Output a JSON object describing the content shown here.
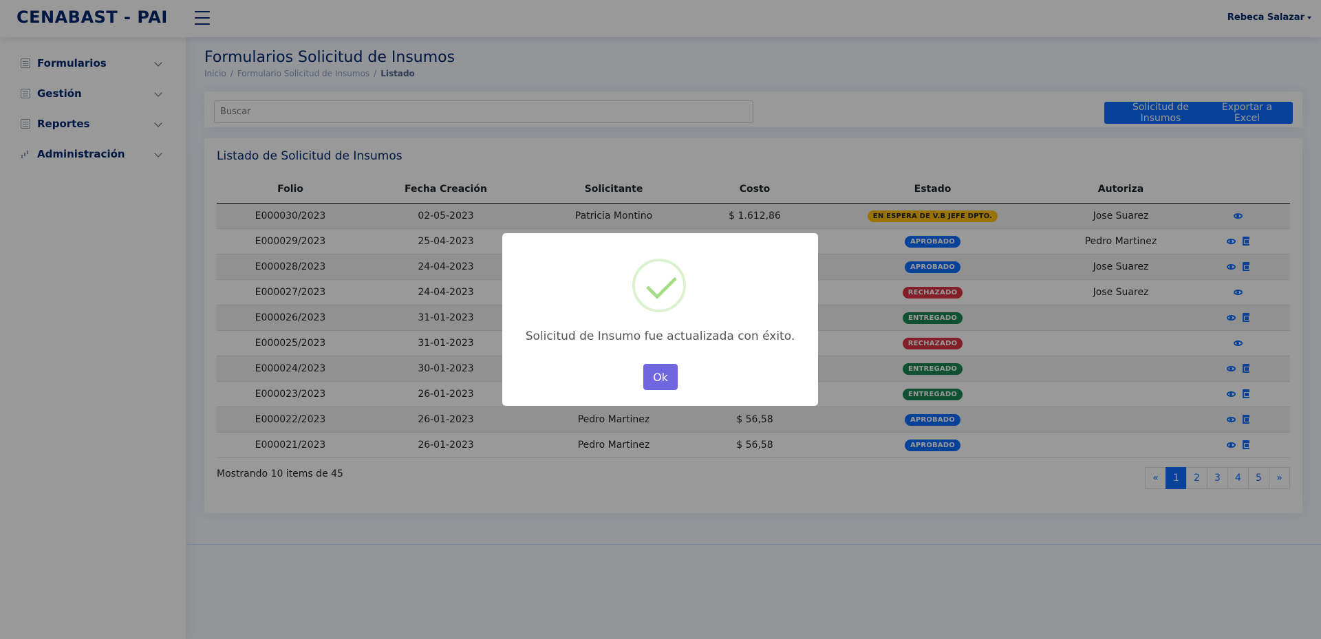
{
  "header": {
    "logo": "CENABAST - PAI",
    "user_name": "Rebeca Salazar"
  },
  "sidebar": {
    "items": [
      {
        "label": "Formularios",
        "icon": "list-icon"
      },
      {
        "label": "Gestión",
        "icon": "document-icon"
      },
      {
        "label": "Reportes",
        "icon": "table-icon"
      },
      {
        "label": "Administración",
        "icon": "bar-chart-icon"
      }
    ]
  },
  "page": {
    "title": "Formularios Solicitud de Insumos",
    "breadcrumb": [
      "Inicio",
      "Formulario Solicitud de Insumos",
      "Listado"
    ]
  },
  "toolbar": {
    "search_placeholder": "Buscar",
    "request_button": "Solicitud de Insumos",
    "export_button": "Exportar a Excel"
  },
  "card": {
    "title": "Listado de Solicitud de Insumos",
    "columns": [
      "Folio",
      "Fecha Creación",
      "Solicitante",
      "Costo",
      "Estado",
      "Autoriza",
      ""
    ],
    "rows": [
      {
        "folio": "E000030/2023",
        "fecha": "02-05-2023",
        "solicitante": "Patricia Montino",
        "costo": "$ 1.612,86",
        "estado": "EN ESPERA DE V.B JEFE DPTO.",
        "estado_color": "warning",
        "autoriza": "Jose Suarez",
        "pdf": false
      },
      {
        "folio": "E000029/2023",
        "fecha": "25-04-2023",
        "solicitante": "",
        "costo": "",
        "estado": "APROBADO",
        "estado_color": "primary",
        "autoriza": "Pedro Martinez",
        "pdf": true
      },
      {
        "folio": "E000028/2023",
        "fecha": "24-04-2023",
        "solicitante": "",
        "costo": "",
        "estado": "APROBADO",
        "estado_color": "primary",
        "autoriza": "Jose Suarez",
        "pdf": true
      },
      {
        "folio": "E000027/2023",
        "fecha": "24-04-2023",
        "solicitante": "",
        "costo": "",
        "estado": "RECHAZADO",
        "estado_color": "danger",
        "autoriza": "Jose Suarez",
        "pdf": false
      },
      {
        "folio": "E000026/2023",
        "fecha": "31-01-2023",
        "solicitante": "",
        "costo": "",
        "estado": "ENTREGADO",
        "estado_color": "success",
        "autoriza": "",
        "pdf": true
      },
      {
        "folio": "E000025/2023",
        "fecha": "31-01-2023",
        "solicitante": "",
        "costo": "",
        "estado": "RECHAZADO",
        "estado_color": "danger",
        "autoriza": "",
        "pdf": false
      },
      {
        "folio": "E000024/2023",
        "fecha": "30-01-2023",
        "solicitante": "",
        "costo": "",
        "estado": "ENTREGADO",
        "estado_color": "success",
        "autoriza": "",
        "pdf": true
      },
      {
        "folio": "E000023/2023",
        "fecha": "26-01-2023",
        "solicitante": "",
        "costo": "",
        "estado": "ENTREGADO",
        "estado_color": "success",
        "autoriza": "",
        "pdf": true
      },
      {
        "folio": "E000022/2023",
        "fecha": "26-01-2023",
        "solicitante": "Pedro Martinez",
        "costo": "$ 56,58",
        "estado": "APROBADO",
        "estado_color": "primary",
        "autoriza": "",
        "pdf": true
      },
      {
        "folio": "E000021/2023",
        "fecha": "26-01-2023",
        "solicitante": "Pedro Martinez",
        "costo": "$ 56,58",
        "estado": "APROBADO",
        "estado_color": "primary",
        "autoriza": "",
        "pdf": true
      }
    ],
    "showing": "Mostrando 10 items de 45",
    "pagination": [
      "«",
      "1",
      "2",
      "3",
      "4",
      "5",
      "»"
    ],
    "active_page": "1"
  },
  "modal": {
    "message": "Solicitud de Insumo fue actualizada con éxito.",
    "ok_label": "Ok",
    "icon": "success-check-icon"
  },
  "colors": {
    "primary": "#0d6efd",
    "navy": "#012970",
    "ok_button": "#7066e0",
    "success_check": "#a5dc86"
  }
}
